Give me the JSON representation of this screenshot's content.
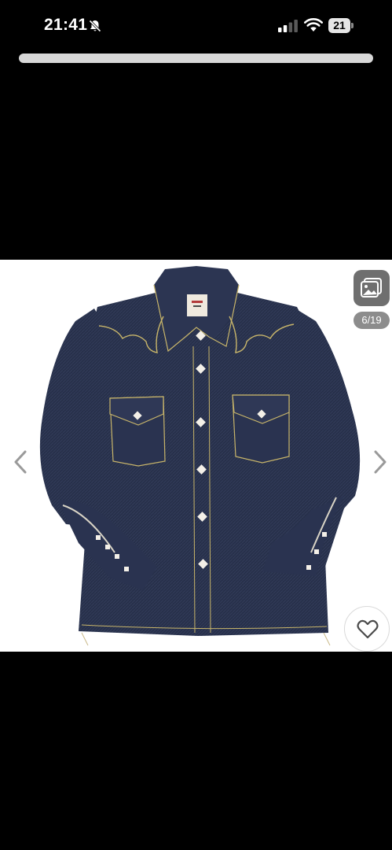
{
  "status_bar": {
    "time": "21:41",
    "battery": "21",
    "icons": [
      "bell-slash-icon",
      "signal-icon",
      "wifi-icon",
      "battery-icon"
    ]
  },
  "viewer": {
    "image_counter": "6/19",
    "icons": [
      "chevron-left-icon",
      "chevron-right-icon",
      "gallery-icon",
      "heart-icon"
    ],
    "colors": {
      "background": "#000000",
      "denim": "#27304a",
      "stitching": "#c8b56a"
    }
  }
}
